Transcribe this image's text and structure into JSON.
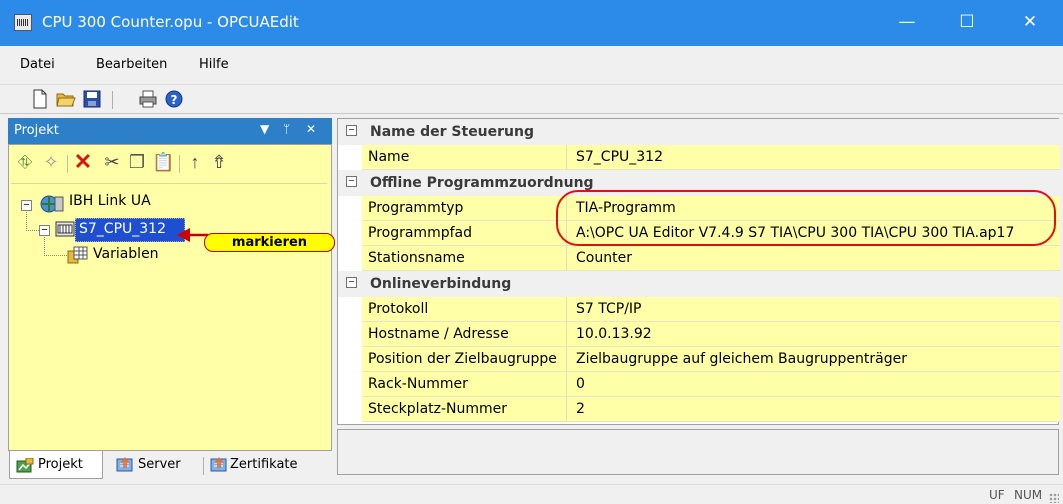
{
  "window": {
    "title": "CPU 300 Counter.opu - OPCUAEdit",
    "min": "—",
    "max": "☐",
    "close": "✕"
  },
  "menu": [
    "Datei",
    "Bearbeiten",
    "Hilfe"
  ],
  "toolbar": {
    "icons": [
      "new-file-icon",
      "open-folder-icon",
      "save-icon",
      "print-icon",
      "help-icon"
    ]
  },
  "project": {
    "title": "Projekt",
    "header_buttons": [
      "▼",
      "ᛘ",
      "✕"
    ],
    "toolbar_icons": [
      "add-icon",
      "add-folder-icon",
      "delete-icon",
      "cut-icon",
      "copy-icon",
      "paste-icon",
      "move-up-icon",
      "move-top-icon"
    ],
    "tree": {
      "root": "IBH Link UA",
      "station": "S7_CPU_312",
      "child": "Variablen"
    },
    "callout": "markieren"
  },
  "tabs": [
    "Projekt",
    "Server",
    "Zertifikate"
  ],
  "grid": {
    "categories": [
      {
        "label": "Name der Steuerung",
        "toggle": "⊟",
        "rows": [
          {
            "name": "Name",
            "value": "S7_CPU_312"
          }
        ]
      },
      {
        "label": "Offline Programmzuordnung",
        "toggle": "⊟",
        "rows": [
          {
            "name": "Programmtyp",
            "value": "TIA-Programm"
          },
          {
            "name": "Programmpfad",
            "value": "A:\\OPC UA Editor V7.4.9 S7 TIA\\CPU 300 TIA\\CPU 300 TIA.ap17"
          },
          {
            "name": "Stationsname",
            "value": "Counter"
          }
        ]
      },
      {
        "label": "Onlineverbindung",
        "toggle": "⊟",
        "rows": [
          {
            "name": "Protokoll",
            "value": "S7 TCP/IP"
          },
          {
            "name": "Hostname / Adresse",
            "value": "10.0.13.92"
          },
          {
            "name": "Position der Zielbaugruppe",
            "value": "Zielbaugruppe auf gleichem Baugruppenträger"
          },
          {
            "name": "Rack-Nummer",
            "value": "0"
          },
          {
            "name": "Steckplatz-Nummer",
            "value": "2"
          }
        ]
      }
    ]
  },
  "status": {
    "uf": "UF",
    "num": "NUM"
  },
  "colors": {
    "titlebar": "#2c8ae8",
    "pane_header": "#2d7fc8",
    "tree_bg": "#ffffa8",
    "selection": "#1f4fd1",
    "ring": "#e01010"
  }
}
